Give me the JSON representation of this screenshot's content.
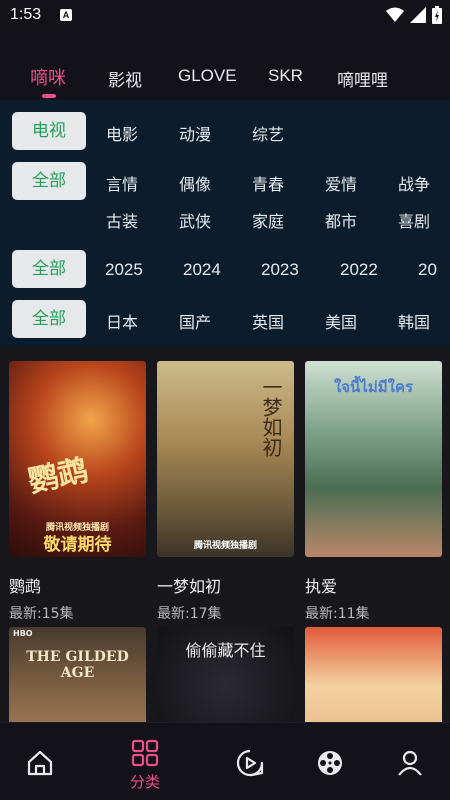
{
  "status_bar": {
    "time": "1:53",
    "notification_icon": "A"
  },
  "top_tabs": [
    {
      "label": "嘀咪",
      "active": true
    },
    {
      "label": "影视",
      "active": false
    },
    {
      "label": "GLOVE",
      "active": false
    },
    {
      "label": "SKR",
      "active": false
    },
    {
      "label": "嘀哩哩",
      "active": false
    }
  ],
  "filters": {
    "type": {
      "selected": "电视",
      "options": [
        "电影",
        "动漫",
        "综艺"
      ]
    },
    "genre": {
      "selected": "全部",
      "options_row1": [
        "言情",
        "偶像",
        "青春",
        "爱情",
        "战争"
      ],
      "options_row2": [
        "古装",
        "武侠",
        "家庭",
        "都市",
        "喜剧"
      ]
    },
    "year": {
      "selected": "全部",
      "options": [
        "2025",
        "2024",
        "2023",
        "2022",
        "20"
      ]
    },
    "region": {
      "selected": "全部",
      "options": [
        "日本",
        "国产",
        "英国",
        "美国",
        "韩国"
      ]
    }
  },
  "items": [
    {
      "title": "鹦鹉",
      "subtitle": "最新:15集",
      "poster_text": "敬请期待",
      "poster_badge": "腾讯视频独播剧",
      "poster_art": "鹦鹉"
    },
    {
      "title": "一梦如初",
      "subtitle": "最新:17集",
      "poster_text": "一梦如初",
      "poster_badge": "腾讯视频独播剧"
    },
    {
      "title": "执爱",
      "subtitle": "最新:11集",
      "poster_text": "ใจนี้ไม่มีใคร"
    },
    {
      "title": "",
      "subtitle": "",
      "poster_text": "THE GILDED AGE",
      "poster_badge": "HBO"
    },
    {
      "title": "",
      "subtitle": "",
      "poster_text": "偷偷藏不住"
    },
    {
      "title": "",
      "subtitle": "",
      "poster_text": ""
    }
  ],
  "bottom_nav": [
    {
      "icon": "home-icon",
      "label": ""
    },
    {
      "icon": "category-grid-icon",
      "label": "分类",
      "active": true
    },
    {
      "icon": "video-play-icon",
      "label": ""
    },
    {
      "icon": "film-reel-icon",
      "label": ""
    },
    {
      "icon": "user-icon",
      "label": ""
    }
  ],
  "colors": {
    "accent": "#ec4d8d",
    "chip_text": "#23a15a",
    "filter_bg": "#0b1d2c"
  }
}
